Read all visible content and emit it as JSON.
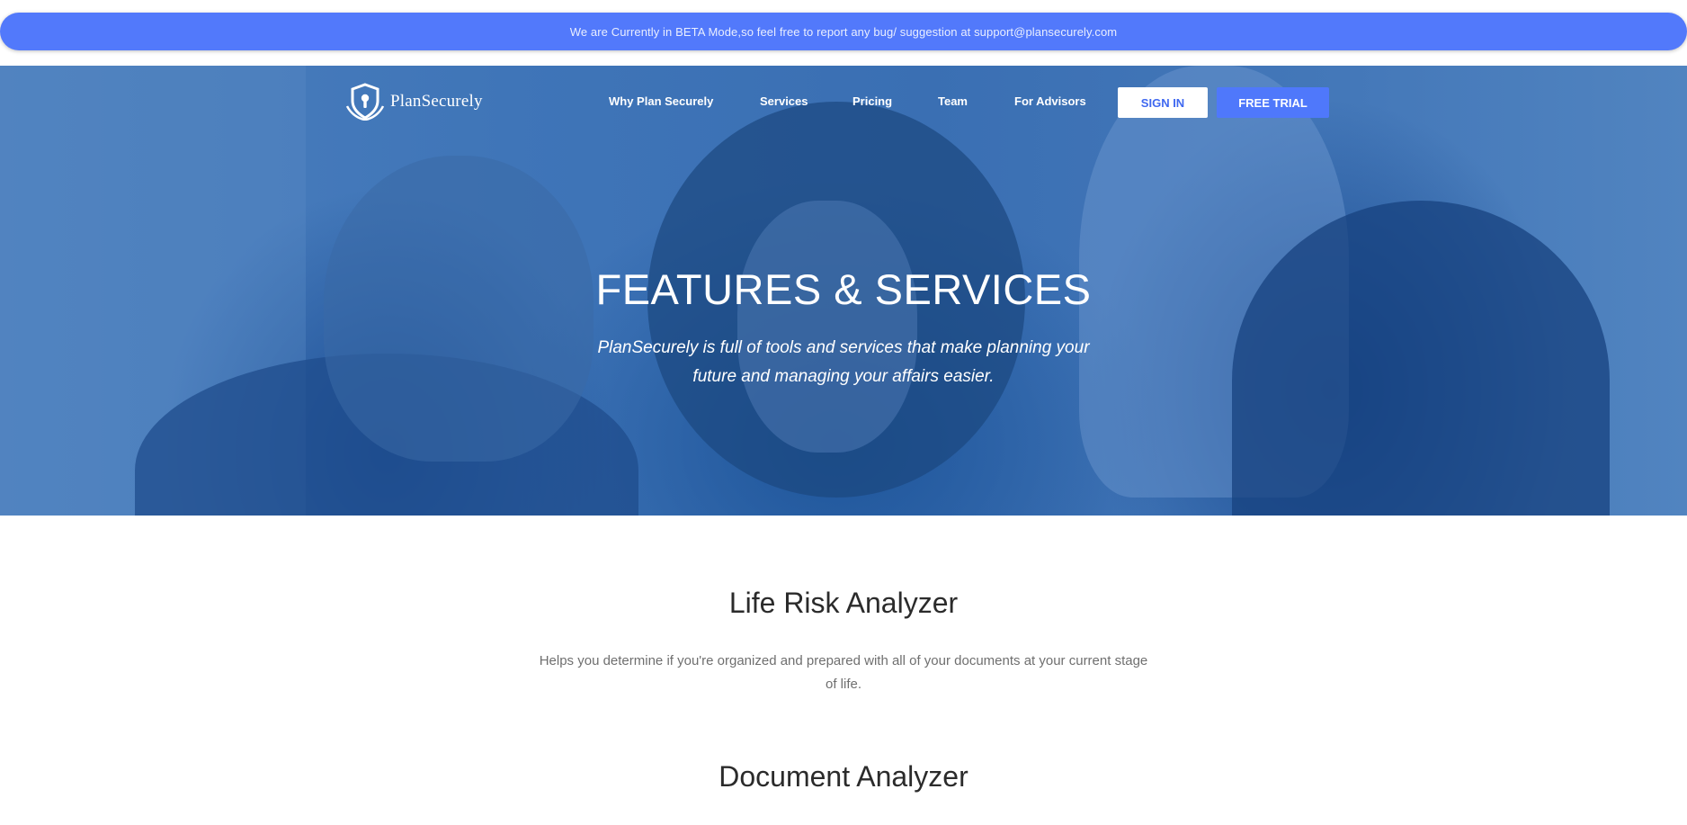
{
  "beta_banner": {
    "text": "We are Currently in BETA Mode,so feel free to report any bug/ suggestion at support@plansecurely.com"
  },
  "header": {
    "logo_text": "PlanSecurely",
    "logo_icon": "shield-keyhole-icon",
    "nav": [
      {
        "label": "Why Plan Securely"
      },
      {
        "label": "Services"
      },
      {
        "label": "Pricing"
      },
      {
        "label": "Team"
      },
      {
        "label": "For Advisors"
      }
    ],
    "signin_label": "SIGN IN",
    "trial_label": "FREE TRIAL"
  },
  "hero": {
    "title": "FEATURES & SERVICES",
    "subtitle": "PlanSecurely is full of tools and services that make planning your future and managing your affairs easier."
  },
  "features": [
    {
      "title": "Life Risk Analyzer",
      "description": "Helps you determine if you're organized and prepared with all of your documents at your current stage of life."
    },
    {
      "title": "Document Analyzer"
    }
  ],
  "colors": {
    "accent": "#5279fb",
    "hero_overlay": "#3f75b8",
    "signin_text": "#3f68f0",
    "heading": "#2b2b2b",
    "body_text": "#6f6f6f"
  }
}
